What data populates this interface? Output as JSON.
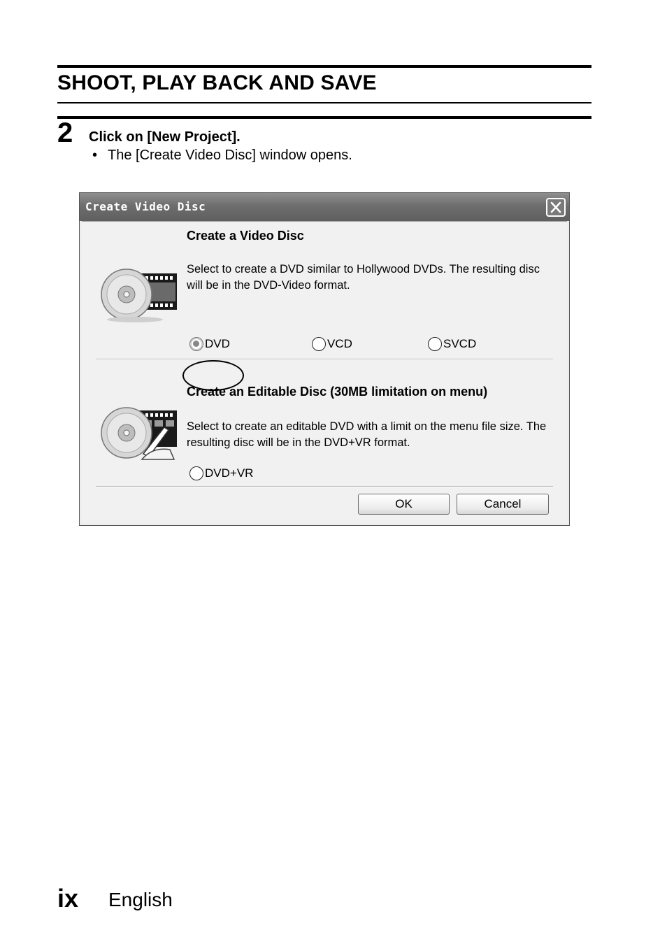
{
  "section": {
    "title": "SHOOT, PLAY BACK AND SAVE"
  },
  "step": {
    "number": "2",
    "heading": "Click on [New Project].",
    "bullet_marker": "•",
    "bullet": "The [Create Video Disc] window opens."
  },
  "dialog": {
    "title": "Create Video Disc",
    "close_icon": "close-x-icon",
    "video_disc": {
      "title": "Create a Video Disc",
      "description": "Select to create a DVD similar to Hollywood DVDs. The resulting disc will be in the DVD-Video format.",
      "icon": "disc-film-icon",
      "options": [
        {
          "label": "DVD",
          "selected": true,
          "highlighted": true
        },
        {
          "label": "VCD",
          "selected": false
        },
        {
          "label": "SVCD",
          "selected": false
        }
      ]
    },
    "editable_disc": {
      "title": "Create an Editable Disc (30MB limitation on menu)",
      "description": "Select to create an editable DVD with a limit on the menu file size. The resulting disc will be in the DVD+VR format.",
      "icon": "disc-edit-icon",
      "options": [
        {
          "label": "DVD+VR",
          "selected": false
        }
      ]
    },
    "buttons": {
      "ok": "OK",
      "cancel": "Cancel"
    }
  },
  "footer": {
    "page": "ix",
    "language": "English"
  }
}
